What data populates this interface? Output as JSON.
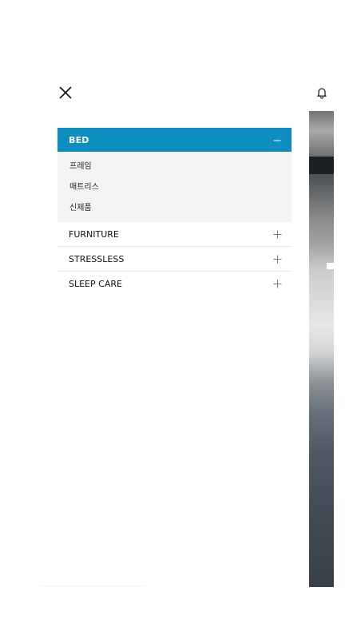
{
  "menu": {
    "active_category": {
      "label": "BED",
      "subitems": [
        "프레임",
        "매트리스",
        "신제품"
      ]
    },
    "categories": [
      {
        "label": "FURNITURE"
      },
      {
        "label": "STRESSLESS"
      },
      {
        "label": "SLEEP CARE"
      }
    ]
  },
  "colors": {
    "accent": "#0e8dc1",
    "submenu_bg": "#f3f3f3"
  },
  "icons": {
    "close": "close-icon",
    "collapse": "minus-icon",
    "expand": "plus-icon",
    "notification": "bell-icon"
  }
}
